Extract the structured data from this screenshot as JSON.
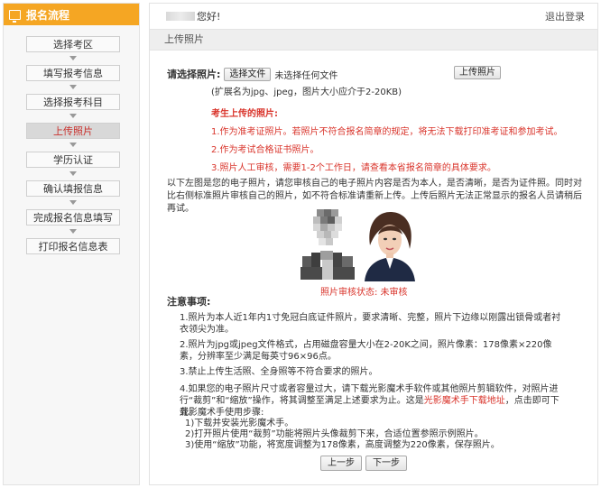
{
  "sidebar": {
    "title": "报名流程",
    "steps": [
      {
        "label": "选择考区"
      },
      {
        "label": "填写报考信息"
      },
      {
        "label": "选择报考科目"
      },
      {
        "label": "上传照片"
      },
      {
        "label": "学历认证"
      },
      {
        "label": "确认填报信息"
      },
      {
        "label": "完成报名信息填写"
      },
      {
        "label": "打印报名信息表"
      }
    ],
    "active_index": 3
  },
  "header": {
    "greeting": "您好!",
    "logout": "退出登录"
  },
  "section": {
    "title": "上传照片"
  },
  "upload": {
    "label": "请选择照片:",
    "choose_button": "选择文件",
    "no_file_text": "未选择任何文件",
    "upload_button": "上传照片",
    "hint": "(扩展名为jpg、jpeg，图片大小应介于2-20KB)"
  },
  "warnings": {
    "title": "考生上传的照片:",
    "items": [
      "1.作为准考证照片。若照片不符合报名简章的规定，将无法下载打印准考证和参加考试。",
      "2.作为考试合格证书照片。",
      "3.照片人工审核，需要1-2个工作日，请查看本省报名简章的具体要求。"
    ]
  },
  "description": "以下左图是您的电子照片，请您审核自己的电子照片内容是否为本人，是否清晰，是否为证件照。同时对比右侧标准照片审核自己的照片，如不符合标准请重新上传。上传后照片无法正常显示的报名人员请稍后再试。",
  "photo_status": "照片审核状态: 未审核",
  "notes": {
    "title": "注意事项:",
    "items": [
      "1.照片为本人近1年内1寸免冠白底证件照片，要求清晰、完整，照片下边缘以刚露出锁骨或者衬衣领尖为准。",
      "2.照片为jpg或jpeg文件格式，占用磁盘容量大小在2-20K之间，照片像素：178像素×220像素，分辨率至少满足每英寸96×96点。",
      "3.禁止上传生活照、全身照等不符合要求的照片。"
    ],
    "item4_part1": "4.如果您的电子照片尺寸或者容量过大，请下载光影魔术手软件或其他照片剪辑软件，对照片进行“裁剪”和“缩放”操作，将其调整至满足上述要求为止。这是",
    "item4_link": "光影魔术手下载地址",
    "item4_part2": "，点击即可下载。",
    "steps_title": "光影魔术手使用步骤:",
    "steps": [
      "1)下载并安装光影魔术手。",
      "2)打开照片使用“裁剪”功能将照片头像裁剪下来，合适位置参照示例照片。",
      "3)使用“缩放”功能，将宽度调整为178像素，高度调整为220像素，保存照片。"
    ]
  },
  "navigation": {
    "prev": "上一步",
    "next": "下一步"
  },
  "colors": {
    "accent": "#f5a623",
    "warning": "#d9342b"
  }
}
